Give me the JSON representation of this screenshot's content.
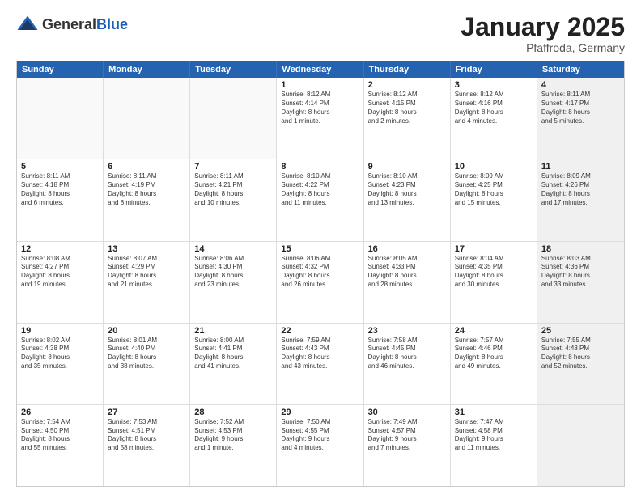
{
  "logo": {
    "general": "General",
    "blue": "Blue"
  },
  "title": "January 2025",
  "subtitle": "Pfaffroda, Germany",
  "days": [
    "Sunday",
    "Monday",
    "Tuesday",
    "Wednesday",
    "Thursday",
    "Friday",
    "Saturday"
  ],
  "rows": [
    [
      {
        "day": "",
        "info": "",
        "empty": true
      },
      {
        "day": "",
        "info": "",
        "empty": true
      },
      {
        "day": "",
        "info": "",
        "empty": true
      },
      {
        "day": "1",
        "info": "Sunrise: 8:12 AM\nSunset: 4:14 PM\nDaylight: 8 hours\nand 1 minute."
      },
      {
        "day": "2",
        "info": "Sunrise: 8:12 AM\nSunset: 4:15 PM\nDaylight: 8 hours\nand 2 minutes."
      },
      {
        "day": "3",
        "info": "Sunrise: 8:12 AM\nSunset: 4:16 PM\nDaylight: 8 hours\nand 4 minutes."
      },
      {
        "day": "4",
        "info": "Sunrise: 8:11 AM\nSunset: 4:17 PM\nDaylight: 8 hours\nand 5 minutes.",
        "shaded": true
      }
    ],
    [
      {
        "day": "5",
        "info": "Sunrise: 8:11 AM\nSunset: 4:18 PM\nDaylight: 8 hours\nand 6 minutes."
      },
      {
        "day": "6",
        "info": "Sunrise: 8:11 AM\nSunset: 4:19 PM\nDaylight: 8 hours\nand 8 minutes."
      },
      {
        "day": "7",
        "info": "Sunrise: 8:11 AM\nSunset: 4:21 PM\nDaylight: 8 hours\nand 10 minutes."
      },
      {
        "day": "8",
        "info": "Sunrise: 8:10 AM\nSunset: 4:22 PM\nDaylight: 8 hours\nand 11 minutes."
      },
      {
        "day": "9",
        "info": "Sunrise: 8:10 AM\nSunset: 4:23 PM\nDaylight: 8 hours\nand 13 minutes."
      },
      {
        "day": "10",
        "info": "Sunrise: 8:09 AM\nSunset: 4:25 PM\nDaylight: 8 hours\nand 15 minutes."
      },
      {
        "day": "11",
        "info": "Sunrise: 8:09 AM\nSunset: 4:26 PM\nDaylight: 8 hours\nand 17 minutes.",
        "shaded": true
      }
    ],
    [
      {
        "day": "12",
        "info": "Sunrise: 8:08 AM\nSunset: 4:27 PM\nDaylight: 8 hours\nand 19 minutes."
      },
      {
        "day": "13",
        "info": "Sunrise: 8:07 AM\nSunset: 4:29 PM\nDaylight: 8 hours\nand 21 minutes."
      },
      {
        "day": "14",
        "info": "Sunrise: 8:06 AM\nSunset: 4:30 PM\nDaylight: 8 hours\nand 23 minutes."
      },
      {
        "day": "15",
        "info": "Sunrise: 8:06 AM\nSunset: 4:32 PM\nDaylight: 8 hours\nand 26 minutes."
      },
      {
        "day": "16",
        "info": "Sunrise: 8:05 AM\nSunset: 4:33 PM\nDaylight: 8 hours\nand 28 minutes."
      },
      {
        "day": "17",
        "info": "Sunrise: 8:04 AM\nSunset: 4:35 PM\nDaylight: 8 hours\nand 30 minutes."
      },
      {
        "day": "18",
        "info": "Sunrise: 8:03 AM\nSunset: 4:36 PM\nDaylight: 8 hours\nand 33 minutes.",
        "shaded": true
      }
    ],
    [
      {
        "day": "19",
        "info": "Sunrise: 8:02 AM\nSunset: 4:38 PM\nDaylight: 8 hours\nand 35 minutes."
      },
      {
        "day": "20",
        "info": "Sunrise: 8:01 AM\nSunset: 4:40 PM\nDaylight: 8 hours\nand 38 minutes."
      },
      {
        "day": "21",
        "info": "Sunrise: 8:00 AM\nSunset: 4:41 PM\nDaylight: 8 hours\nand 41 minutes."
      },
      {
        "day": "22",
        "info": "Sunrise: 7:59 AM\nSunset: 4:43 PM\nDaylight: 8 hours\nand 43 minutes."
      },
      {
        "day": "23",
        "info": "Sunrise: 7:58 AM\nSunset: 4:45 PM\nDaylight: 8 hours\nand 46 minutes."
      },
      {
        "day": "24",
        "info": "Sunrise: 7:57 AM\nSunset: 4:46 PM\nDaylight: 8 hours\nand 49 minutes."
      },
      {
        "day": "25",
        "info": "Sunrise: 7:55 AM\nSunset: 4:48 PM\nDaylight: 8 hours\nand 52 minutes.",
        "shaded": true
      }
    ],
    [
      {
        "day": "26",
        "info": "Sunrise: 7:54 AM\nSunset: 4:50 PM\nDaylight: 8 hours\nand 55 minutes."
      },
      {
        "day": "27",
        "info": "Sunrise: 7:53 AM\nSunset: 4:51 PM\nDaylight: 8 hours\nand 58 minutes."
      },
      {
        "day": "28",
        "info": "Sunrise: 7:52 AM\nSunset: 4:53 PM\nDaylight: 9 hours\nand 1 minute."
      },
      {
        "day": "29",
        "info": "Sunrise: 7:50 AM\nSunset: 4:55 PM\nDaylight: 9 hours\nand 4 minutes."
      },
      {
        "day": "30",
        "info": "Sunrise: 7:49 AM\nSunset: 4:57 PM\nDaylight: 9 hours\nand 7 minutes."
      },
      {
        "day": "31",
        "info": "Sunrise: 7:47 AM\nSunset: 4:58 PM\nDaylight: 9 hours\nand 11 minutes."
      },
      {
        "day": "",
        "info": "",
        "empty": true,
        "shaded": true
      }
    ]
  ]
}
